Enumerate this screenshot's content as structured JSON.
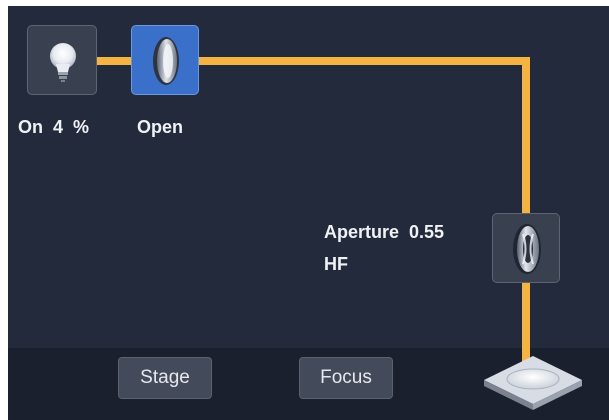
{
  "lamp": {
    "state": "On",
    "value": "4",
    "unit": "%",
    "icon": "light-bulb-icon"
  },
  "shutter": {
    "label": "Open",
    "icon": "shutter-lens-icon"
  },
  "condenser": {
    "aperture_label": "Aperture",
    "aperture_value": "0.55",
    "mode": "HF",
    "icon": "condenser-lens-icon"
  },
  "toolbar": {
    "stage_label": "Stage",
    "focus_label": "Focus"
  },
  "stage_icon": "stage-plate-icon",
  "colors": {
    "beam": "#f5b344",
    "background": "#232a3b",
    "active_tile": "#3a70c9"
  }
}
